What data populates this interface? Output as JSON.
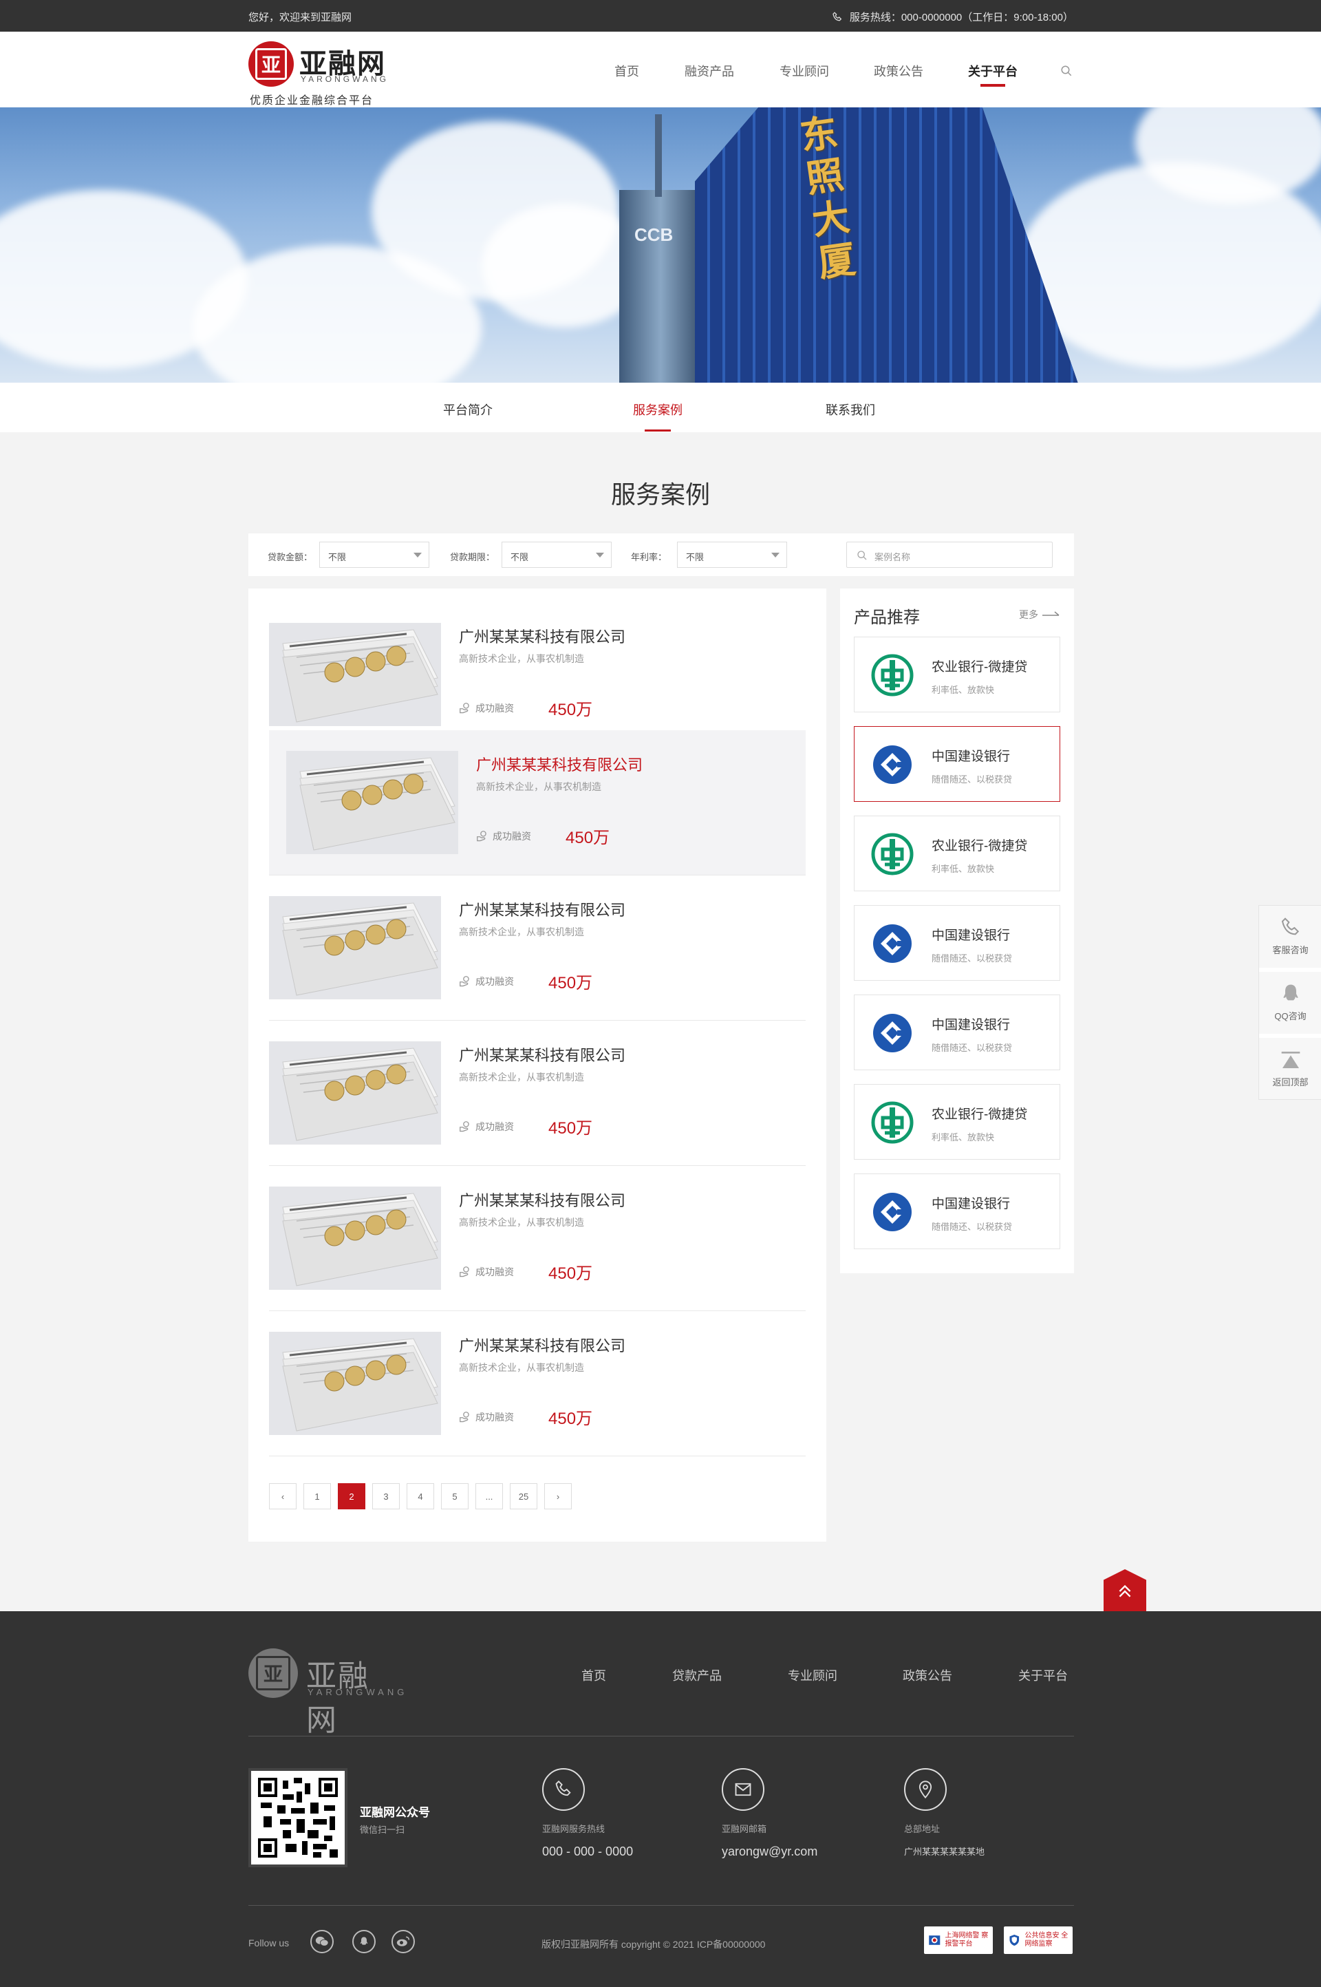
{
  "topbar": {
    "welcome": "您好，欢迎来到亚融网",
    "hotline": "服务热线：000-0000000（工作日：9:00-18:00）"
  },
  "header": {
    "logo": {
      "name": "亚融网",
      "pinyin": "YARONGWANG",
      "slogan": "优质企业金融综合平台"
    },
    "nav": [
      {
        "label": "首页"
      },
      {
        "label": "融资产品"
      },
      {
        "label": "专业顾问"
      },
      {
        "label": "政策公告"
      },
      {
        "label": "关于平台",
        "active": true
      }
    ]
  },
  "banner": {
    "building_sign": "东照大厦",
    "tower_logo": "CCB"
  },
  "subnav": [
    {
      "label": "平台简介"
    },
    {
      "label": "服务案例",
      "active": true
    },
    {
      "label": "联系我们"
    }
  ],
  "section_title": "服务案例",
  "filters": {
    "amount_label": "贷款金额：",
    "amount_value": "不限",
    "term_label": "贷款期限：",
    "term_value": "不限",
    "rate_label": "年利率：",
    "rate_value": "不限",
    "search_placeholder": "案例名称"
  },
  "cases": [
    {
      "title": "广州某某某科技有限公司",
      "desc": "高新技术企业，从事农机制造",
      "success_label": "成功融资",
      "amount": "450万"
    },
    {
      "title": "广州某某某科技有限公司",
      "desc": "高新技术企业，从事农机制造",
      "success_label": "成功融资",
      "amount": "450万",
      "highlighted": true
    },
    {
      "title": "广州某某某科技有限公司",
      "desc": "高新技术企业，从事农机制造",
      "success_label": "成功融资",
      "amount": "450万"
    },
    {
      "title": "广州某某某科技有限公司",
      "desc": "高新技术企业，从事农机制造",
      "success_label": "成功融资",
      "amount": "450万"
    },
    {
      "title": "广州某某某科技有限公司",
      "desc": "高新技术企业，从事农机制造",
      "success_label": "成功融资",
      "amount": "450万"
    },
    {
      "title": "广州某某某科技有限公司",
      "desc": "高新技术企业，从事农机制造",
      "success_label": "成功融资",
      "amount": "450万"
    }
  ],
  "pagination": {
    "prev": "‹",
    "pages": [
      "1",
      "2",
      "3",
      "4",
      "5",
      "...",
      "25"
    ],
    "current": "2",
    "next": "›"
  },
  "sidebar": {
    "title": "产品推荐",
    "more": "更多",
    "products": [
      {
        "name": "农业银行-微捷贷",
        "desc": "利率低、放款快",
        "bank": "abc"
      },
      {
        "name": "中国建设银行",
        "desc": "随借随还、以税获贷",
        "bank": "ccb",
        "selected": true
      },
      {
        "name": "农业银行-微捷贷",
        "desc": "利率低、放款快",
        "bank": "abc"
      },
      {
        "name": "中国建设银行",
        "desc": "随借随还、以税获贷",
        "bank": "ccb"
      },
      {
        "name": "中国建设银行",
        "desc": "随借随还、以税获贷",
        "bank": "ccb"
      },
      {
        "name": "农业银行-微捷贷",
        "desc": "利率低、放款快",
        "bank": "abc"
      },
      {
        "name": "中国建设银行",
        "desc": "随借随还、以税获贷",
        "bank": "ccb"
      }
    ]
  },
  "float_bar": {
    "service": "客服咨询",
    "qq": "QQ咨询",
    "top": "返回顶部"
  },
  "footer": {
    "logo": {
      "name": "亚融网",
      "pinyin": "YARONGWANG"
    },
    "nav": [
      "首页",
      "贷款产品",
      "专业顾问",
      "政策公告",
      "关于平台"
    ],
    "qr_title": "亚融网公众号",
    "qr_sub": "微信扫一扫",
    "hotline_label": "亚融网服务热线",
    "hotline_value": "000 - 000 - 0000",
    "email_label": "亚融网邮箱",
    "email_value": "yarongw@yr.com",
    "address_label": "总部地址",
    "address_value": "广州某某某某某某地",
    "follow": "Follow us",
    "copyright": "版权归亚融网所有    copyright © 2021  ICP备00000000",
    "badge1": "上海网络警 察报警平台",
    "badge2": "公共信息安 全网络监察"
  },
  "colors": {
    "brand_red": "#c4161c",
    "dark": "#333333",
    "abc_green": "#0f9a6c",
    "ccb_blue": "#1e57b0"
  }
}
